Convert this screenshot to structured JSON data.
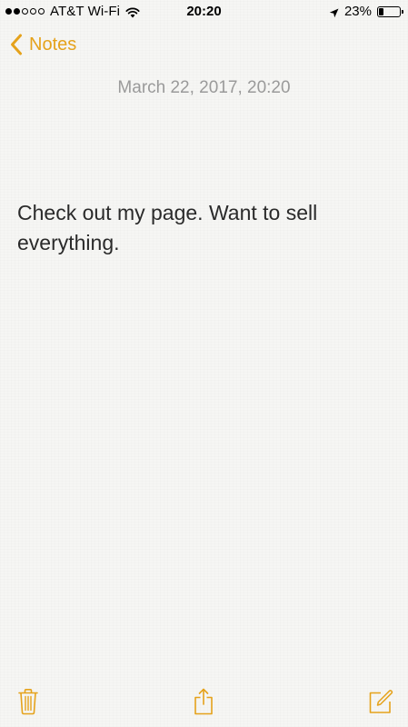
{
  "status_bar": {
    "carrier": "AT&T Wi-Fi",
    "time": "20:20",
    "battery": "23%",
    "battery_level": 0.23,
    "signal_filled": 2,
    "signal_total": 5,
    "icons": [
      "signal-dots-icon",
      "wifi-icon",
      "location-arrow-icon",
      "battery-icon"
    ]
  },
  "nav": {
    "back_label": "Notes",
    "back_icon": "chevron-left-icon"
  },
  "note": {
    "date": "March 22, 2017, 20:20",
    "body": "Check out my page. Want to sell everything."
  },
  "toolbar": {
    "icons": [
      "trash-icon",
      "share-icon",
      "compose-icon"
    ]
  },
  "colors": {
    "accent": "#e5a21b",
    "background": "#f6f6f4",
    "date_text": "#9a9a9a",
    "body_text": "#2a2a2a"
  }
}
